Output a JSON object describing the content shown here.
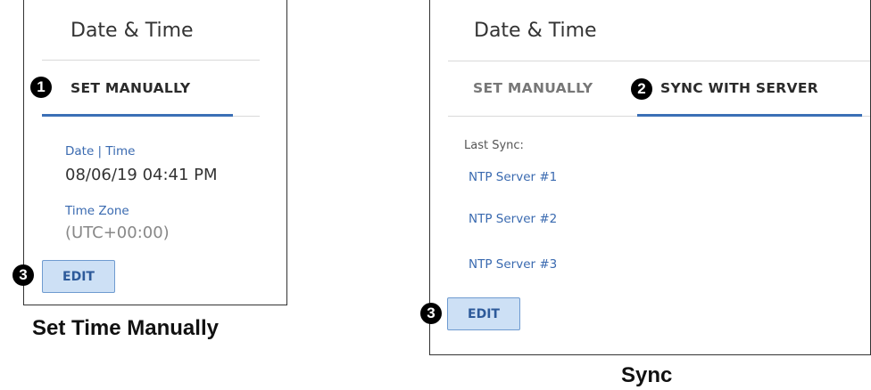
{
  "set_manually_panel": {
    "title": "Date & Time",
    "tab_callout": "1",
    "tab_label": "SET MANUALLY",
    "date_time_label": "Date | Time",
    "date_time_value": "08/06/19 04:41 PM",
    "time_zone_label": "Time Zone",
    "time_zone_value": "(UTC+00:00)",
    "edit_callout": "3",
    "edit_label": "EDIT",
    "caption": "Set Time Manually"
  },
  "sync_panel": {
    "title": "Date & Time",
    "inactive_tab_label": "SET MANUALLY",
    "tab_callout": "2",
    "active_tab_label": "SYNC WITH SERVER",
    "last_sync_label": "Last Sync:",
    "servers": [
      "NTP Server #1",
      "NTP Server #2",
      "NTP Server #3"
    ],
    "edit_callout": "3",
    "edit_label": "EDIT",
    "caption": "Sync"
  },
  "colors": {
    "accent": "#3b6fb6",
    "link": "#3a6ab0",
    "button_fill": "#cde0f5",
    "button_border": "#6f9bd0"
  }
}
